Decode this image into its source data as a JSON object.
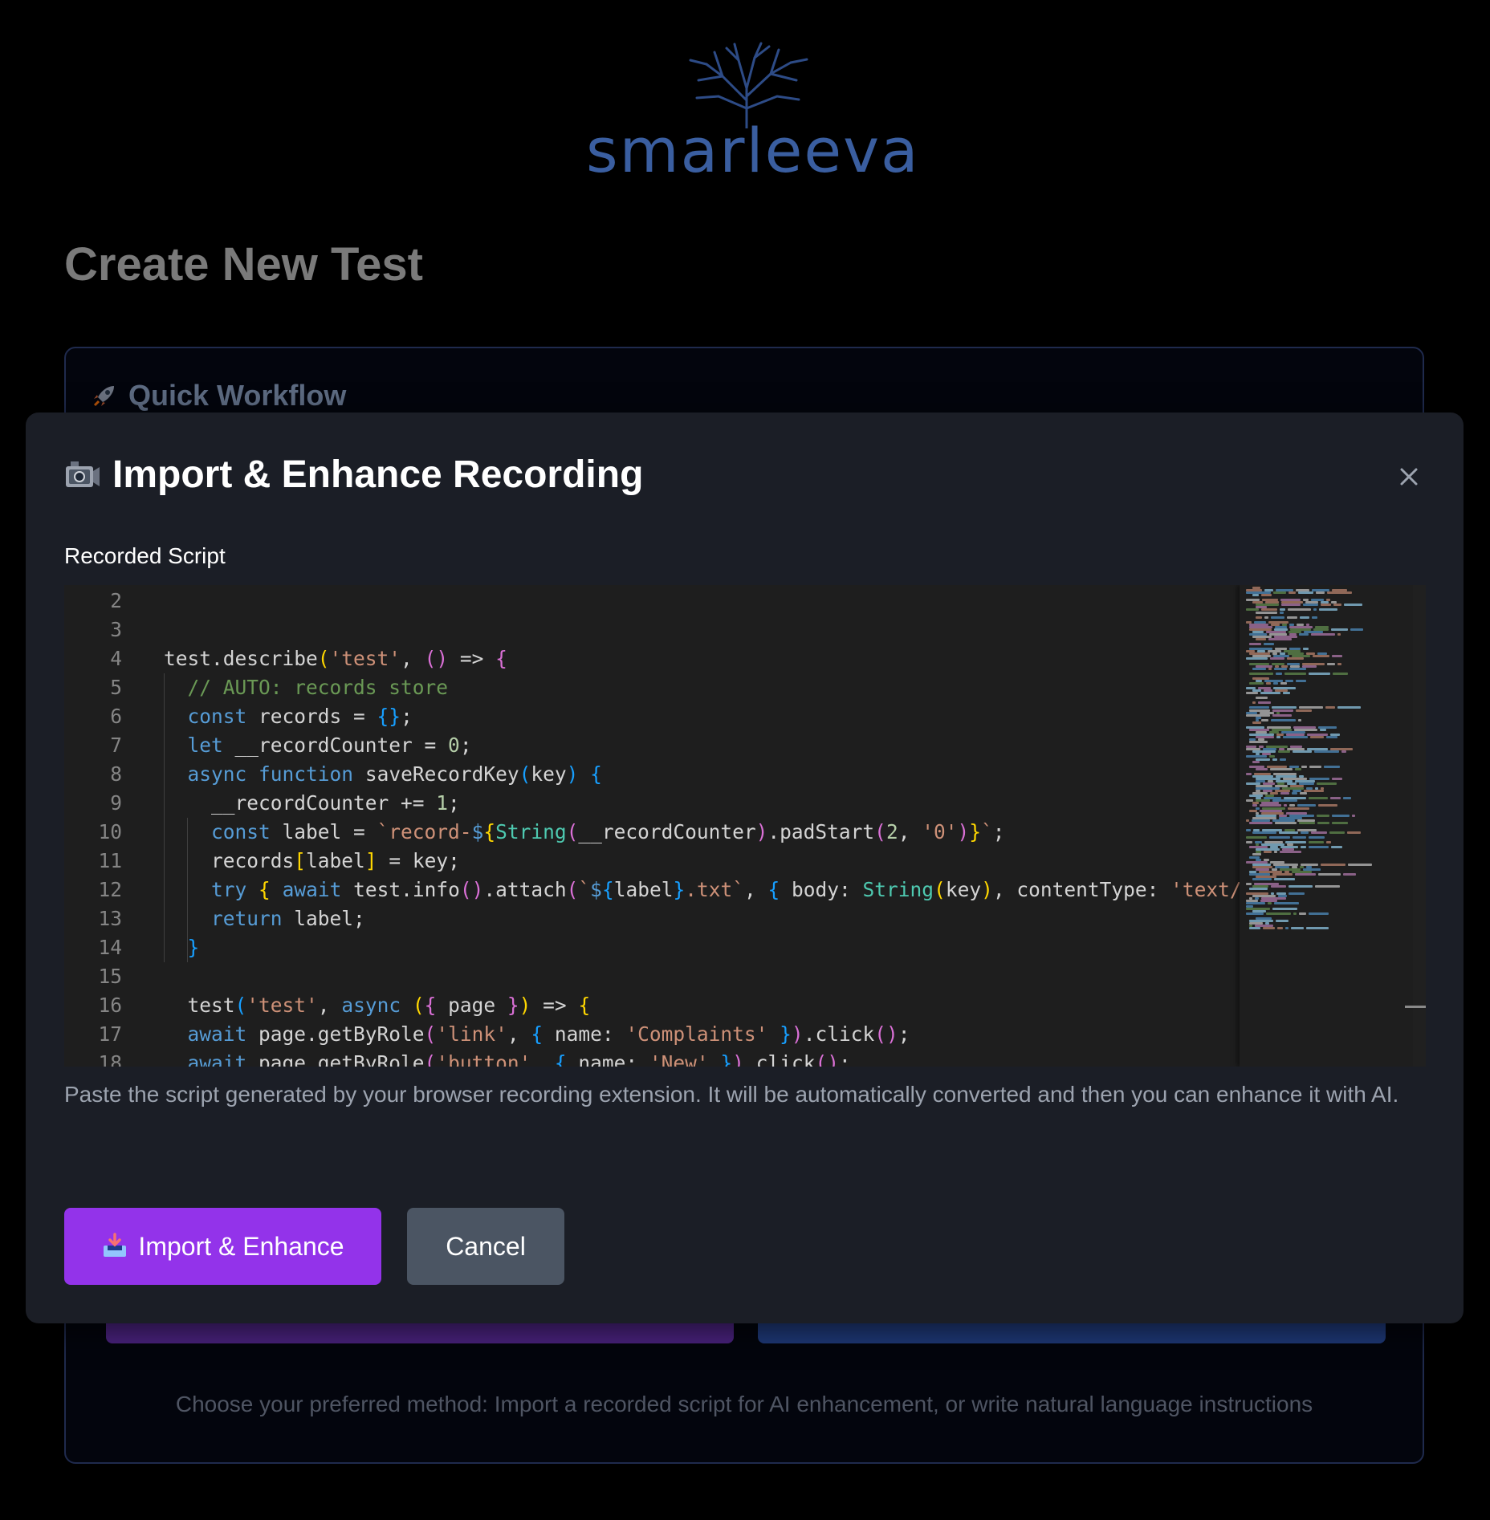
{
  "logo": {
    "text": "smarleeva"
  },
  "page": {
    "title": "Create New Test"
  },
  "workflow": {
    "icon": "rocket-icon",
    "title": "Quick Workflow",
    "hint": "Choose your preferred method: Import a recorded script for AI enhancement, or write natural language instructions"
  },
  "modal": {
    "icon": "video-camera-icon",
    "title": "Import & Enhance Recording",
    "close_icon": "close-icon",
    "field_label": "Recorded Script",
    "help_text": "Paste the script generated by your browser recording extension. It will be automatically converted and then you can enhance it with AI.",
    "import_button": {
      "icon": "inbox-tray-icon",
      "label": "Import & Enhance"
    },
    "cancel_button": {
      "label": "Cancel"
    }
  },
  "editor": {
    "lines": [
      {
        "n": "2",
        "tokens": []
      },
      {
        "n": "3",
        "tokens": []
      },
      {
        "n": "4",
        "tokens": [
          [
            "",
            "test.describe"
          ],
          [
            "b1",
            "("
          ],
          [
            "str",
            "'test'"
          ],
          [
            "",
            ", "
          ],
          [
            "b2",
            "()"
          ],
          [
            "",
            " => "
          ],
          [
            "b2",
            "{"
          ]
        ]
      },
      {
        "n": "5",
        "tokens": [
          [
            "",
            "  "
          ],
          [
            "cm",
            "// AUTO: records store"
          ]
        ]
      },
      {
        "n": "6",
        "tokens": [
          [
            "",
            "  "
          ],
          [
            "kw",
            "const"
          ],
          [
            "",
            " records = "
          ],
          [
            "b3",
            "{}"
          ],
          [
            "",
            ";"
          ]
        ]
      },
      {
        "n": "7",
        "tokens": [
          [
            "",
            "  "
          ],
          [
            "kw",
            "let"
          ],
          [
            "",
            " __recordCounter = "
          ],
          [
            "num",
            "0"
          ],
          [
            "",
            ";"
          ]
        ]
      },
      {
        "n": "8",
        "tokens": [
          [
            "",
            "  "
          ],
          [
            "kw",
            "async"
          ],
          [
            "",
            " "
          ],
          [
            "kw",
            "function"
          ],
          [
            "",
            " saveRecordKey"
          ],
          [
            "b3",
            "("
          ],
          [
            "",
            "key"
          ],
          [
            "b3",
            ")"
          ],
          [
            "",
            " "
          ],
          [
            "b3",
            "{"
          ]
        ]
      },
      {
        "n": "9",
        "tokens": [
          [
            "",
            "    __recordCounter += "
          ],
          [
            "num",
            "1"
          ],
          [
            "",
            ";"
          ]
        ]
      },
      {
        "n": "10",
        "tokens": [
          [
            "",
            "    "
          ],
          [
            "kw",
            "const"
          ],
          [
            "",
            " label = "
          ],
          [
            "str",
            "`record-"
          ],
          [
            "kw",
            "$"
          ],
          [
            "b1",
            "{"
          ],
          [
            "type",
            "String"
          ],
          [
            "b2",
            "("
          ],
          [
            "",
            "__recordCounter"
          ],
          [
            "b2",
            ")"
          ],
          [
            "",
            ".padStart"
          ],
          [
            "b2",
            "("
          ],
          [
            "num",
            "2"
          ],
          [
            "",
            ", "
          ],
          [
            "str",
            "'0'"
          ],
          [
            "b2",
            ")"
          ],
          [
            "b1",
            "}"
          ],
          [
            "str",
            "`"
          ],
          [
            "",
            ";"
          ]
        ]
      },
      {
        "n": "11",
        "tokens": [
          [
            "",
            "    records"
          ],
          [
            "b1",
            "["
          ],
          [
            "",
            "label"
          ],
          [
            "b1",
            "]"
          ],
          [
            "",
            " = key;"
          ]
        ]
      },
      {
        "n": "12",
        "tokens": [
          [
            "",
            "    "
          ],
          [
            "kw",
            "try"
          ],
          [
            "",
            " "
          ],
          [
            "b1",
            "{"
          ],
          [
            "",
            " "
          ],
          [
            "kw",
            "await"
          ],
          [
            "",
            " test.info"
          ],
          [
            "b2",
            "()"
          ],
          [
            "",
            ".attach"
          ],
          [
            "b2",
            "("
          ],
          [
            "str",
            "`"
          ],
          [
            "kw",
            "$"
          ],
          [
            "b3",
            "{"
          ],
          [
            "",
            "label"
          ],
          [
            "b3",
            "}"
          ],
          [
            "str",
            ".txt`"
          ],
          [
            "",
            ", "
          ],
          [
            "b3",
            "{"
          ],
          [
            "",
            " body: "
          ],
          [
            "type",
            "String"
          ],
          [
            "b1",
            "("
          ],
          [
            "",
            "key"
          ],
          [
            "b1",
            ")"
          ],
          [
            "",
            ", contentType: "
          ],
          [
            "str",
            "'text/pl"
          ]
        ]
      },
      {
        "n": "13",
        "tokens": [
          [
            "",
            "    "
          ],
          [
            "kw",
            "return"
          ],
          [
            "",
            " label;"
          ]
        ]
      },
      {
        "n": "14",
        "tokens": [
          [
            "",
            "  "
          ],
          [
            "b3",
            "}"
          ]
        ]
      },
      {
        "n": "15",
        "tokens": []
      },
      {
        "n": "16",
        "tokens": [
          [
            "",
            "  test"
          ],
          [
            "b3",
            "("
          ],
          [
            "str",
            "'test'"
          ],
          [
            "",
            ", "
          ],
          [
            "kw",
            "async"
          ],
          [
            "",
            " "
          ],
          [
            "b1",
            "("
          ],
          [
            "b2",
            "{"
          ],
          [
            "",
            " page "
          ],
          [
            "b2",
            "}"
          ],
          [
            "b1",
            ")"
          ],
          [
            "",
            " => "
          ],
          [
            "b1",
            "{"
          ]
        ]
      },
      {
        "n": "17",
        "tokens": [
          [
            "",
            "  "
          ],
          [
            "kw",
            "await"
          ],
          [
            "",
            " page.getByRole"
          ],
          [
            "b2",
            "("
          ],
          [
            "str",
            "'link'"
          ],
          [
            "",
            ", "
          ],
          [
            "b3",
            "{"
          ],
          [
            "",
            " name: "
          ],
          [
            "str",
            "'Complaints'"
          ],
          [
            "",
            " "
          ],
          [
            "b3",
            "}"
          ],
          [
            "b2",
            ")"
          ],
          [
            "",
            ".click"
          ],
          [
            "b2",
            "()"
          ],
          [
            "",
            ";"
          ]
        ]
      },
      {
        "n": "18",
        "tokens": [
          [
            "",
            "  "
          ],
          [
            "kw",
            "await"
          ],
          [
            "",
            " page.getByRole"
          ],
          [
            "b2",
            "("
          ],
          [
            "str",
            "'button'"
          ],
          [
            "",
            ", "
          ],
          [
            "b3",
            "{"
          ],
          [
            "",
            " name: "
          ],
          [
            "str",
            "'New'"
          ],
          [
            "",
            " "
          ],
          [
            "b3",
            "}"
          ],
          [
            "b2",
            ")"
          ],
          [
            "",
            ".click"
          ],
          [
            "b2",
            "()"
          ],
          [
            "",
            ";"
          ]
        ]
      }
    ]
  },
  "colors": {
    "accent_purple": "#9333ea",
    "cancel_gray": "#4b5563",
    "modal_bg": "#1b1e26",
    "editor_bg": "#1e1e1e",
    "logo_blue": "#3a5ea0"
  }
}
